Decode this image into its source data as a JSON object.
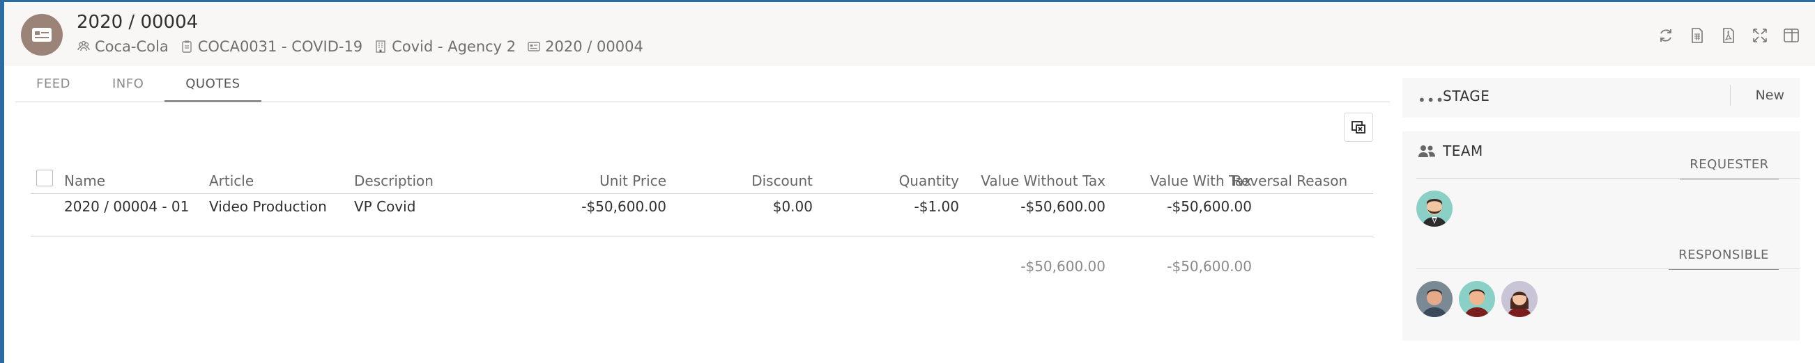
{
  "header": {
    "title": "2020 / 00004",
    "customer": "Coca-Cola",
    "project": "COCA0031 - COVID-19",
    "agency": "Covid - Agency 2",
    "reference": "2020 / 00004"
  },
  "toolbar": {
    "icons": [
      "refresh-icon",
      "spreadsheet-icon",
      "pdf-icon",
      "expand-icon",
      "split-view-icon"
    ]
  },
  "tabs": [
    {
      "label": "FEED",
      "active": false
    },
    {
      "label": "INFO",
      "active": false
    },
    {
      "label": "QUOTES",
      "active": true
    }
  ],
  "quotes": {
    "columns": [
      "Name",
      "Article",
      "Description",
      "Unit Price",
      "Discount",
      "Quantity",
      "Value Without Tax",
      "Value With Tax",
      "Reversal Reason"
    ],
    "rows": [
      {
        "name": "2020 / 00004 - 01",
        "article": "Video Production",
        "description": "VP Covid",
        "unit_price": "-$50,600.00",
        "discount": "$0.00",
        "quantity": "-$1.00",
        "value_without_tax": "-$50,600.00",
        "value_with_tax": "-$50,600.00",
        "reversal_reason": ""
      }
    ],
    "totals": {
      "value_without_tax": "-$50,600.00",
      "value_with_tax": "-$50,600.00"
    }
  },
  "side": {
    "stage_label": "STAGE",
    "stage_value": "New",
    "team_label": "TEAM",
    "requester_label": "REQUESTER",
    "responsible_label": "RESPONSIBLE"
  },
  "colors": {
    "accent": "#2b6ca3",
    "avatar_bg": "#9c8378"
  }
}
